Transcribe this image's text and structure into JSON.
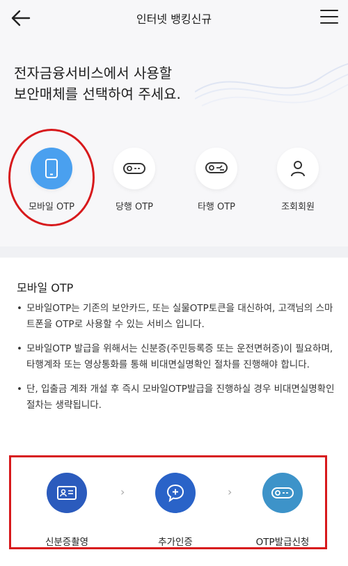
{
  "header": {
    "title": "인터넷 뱅킹신규"
  },
  "headline": {
    "line1": "전자금융서비스에서 사용할",
    "line2": "보안매체를 선택하여 주세요."
  },
  "options": [
    {
      "label": "모바일 OTP",
      "icon": "smartphone-icon",
      "selected": true
    },
    {
      "label": "당행 OTP",
      "icon": "otp-token-icon",
      "selected": false
    },
    {
      "label": "타행 OTP",
      "icon": "other-bank-otp-icon",
      "selected": false
    },
    {
      "label": "조회회원",
      "icon": "user-icon",
      "selected": false
    }
  ],
  "detail": {
    "title": "모바일 OTP",
    "bullets": [
      "모바일OTP는 기존의 보안카드, 또는 실물OTP토큰을 대신하여, 고객님의 스마트폰을 OTP로 사용할 수 있는 서비스 입니다.",
      "모바일OTP 발급을 위해서는 신분증(주민등록증 또는 운전면허증)이 필요하며, 타행계좌 또는 영상통화를 통해 비대면실명확인 절차를 진행해야 합니다.",
      "단, 입출금 계좌 개설 후 즉시 모바일OTP발급을 진행하실 경우 비대면실명확인 절차는 생략됩니다."
    ]
  },
  "steps": [
    {
      "label": "신분증촬영",
      "icon": "id-card-icon",
      "color": "#2b5bbd"
    },
    {
      "label": "추가인증",
      "icon": "chat-plus-icon",
      "color": "#2a63c8"
    },
    {
      "label": "OTP발급신청",
      "icon": "otp-token-icon",
      "color": "#3d93c9"
    }
  ],
  "colors": {
    "accent": "#4aa0ef",
    "highlight": "#d7191c"
  }
}
